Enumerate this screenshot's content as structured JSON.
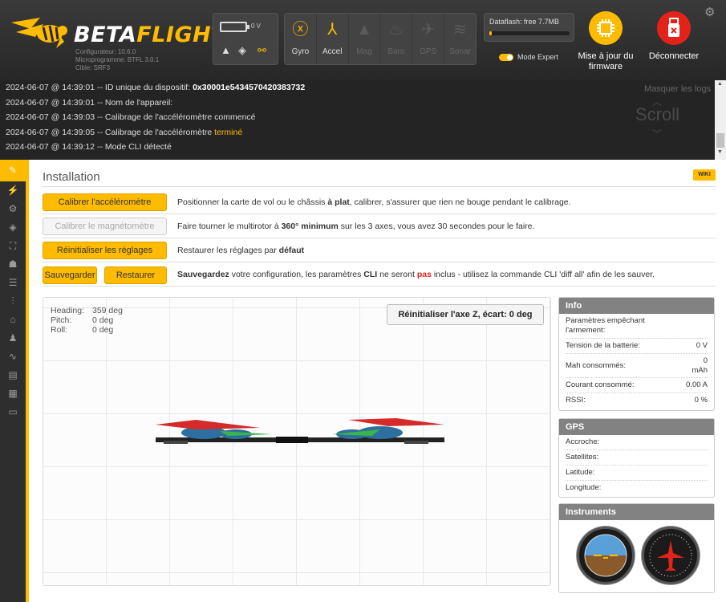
{
  "app": {
    "logo_part1": "BETA",
    "logo_part2": "FLIGHT",
    "configurator": "Configurateur: 10.6.0",
    "firmware": "Microprogramme: BTFL 3.0.1",
    "target": "Cible: SRF3"
  },
  "battery": {
    "voltage": "0 V"
  },
  "sensors": [
    {
      "label": "Gyro",
      "icon": "gyro-icon",
      "active": true
    },
    {
      "label": "Accel",
      "icon": "accel-icon",
      "active": true
    },
    {
      "label": "Mag",
      "icon": "mag-icon",
      "active": false
    },
    {
      "label": "Baro",
      "icon": "baro-icon",
      "active": false
    },
    {
      "label": "GPS",
      "icon": "gps-icon",
      "active": false
    },
    {
      "label": "Sonar",
      "icon": "sonar-icon",
      "active": false
    }
  ],
  "dataflash": {
    "label": "Dataflash: free 7.7MB",
    "used_fraction": 0.03
  },
  "expert_mode": {
    "label": "Mode Expert",
    "enabled": true
  },
  "header_buttons": {
    "firmware_update": "Mise à jour du firmware",
    "disconnect": "Déconnecter"
  },
  "log": {
    "lines": [
      {
        "prefix": "2024-06-07 @ 14:39:01 -- ID unique du dispositif: ",
        "bold": "0x30001e5434570420383732",
        "suffix": ""
      },
      {
        "prefix": "2024-06-07 @ 14:39:01 -- Nom de l'appareil:",
        "bold": "",
        "suffix": ""
      },
      {
        "prefix": "2024-06-07 @ 14:39:03 -- Calibrage de l'accéléromètre commencé",
        "bold": "",
        "suffix": ""
      },
      {
        "prefix": "2024-06-07 @ 14:39:05 -- Calibrage de l'accéléromètre ",
        "bold": "",
        "suffix": "terminé"
      },
      {
        "prefix": "2024-06-07 @ 14:39:12 -- Mode CLI détecté",
        "bold": "",
        "suffix": ""
      }
    ],
    "hide_label": "Masquer les logs",
    "scroll_label": "Scroll"
  },
  "sidebar": [
    {
      "name": "nav-setup",
      "icon": "wrench-icon",
      "glyph": "✎",
      "active": true
    },
    {
      "name": "nav-ports",
      "icon": "plug-icon",
      "glyph": "⚡",
      "active": false
    },
    {
      "name": "nav-configuration",
      "icon": "gear-icon",
      "glyph": "⚙",
      "active": false
    },
    {
      "name": "nav-failsafe",
      "icon": "shield-icon",
      "glyph": "◈",
      "active": false
    },
    {
      "name": "nav-pid",
      "icon": "pid-icon",
      "glyph": "⛶",
      "active": false
    },
    {
      "name": "nav-receiver",
      "icon": "receiver-icon",
      "glyph": "☗",
      "active": false
    },
    {
      "name": "nav-modes",
      "icon": "modes-icon",
      "glyph": "☰",
      "active": false
    },
    {
      "name": "nav-adjustments",
      "icon": "sliders-icon",
      "glyph": "⫶",
      "active": false
    },
    {
      "name": "nav-servos",
      "icon": "servo-icon",
      "glyph": "⌂",
      "active": false
    },
    {
      "name": "nav-motors",
      "icon": "motor-icon",
      "glyph": "♟",
      "active": false
    },
    {
      "name": "nav-sensors",
      "icon": "sensors-icon",
      "glyph": "∿",
      "active": false
    },
    {
      "name": "nav-blackbox",
      "icon": "blackbox-icon",
      "glyph": "▤",
      "active": false
    },
    {
      "name": "nav-led",
      "icon": "led-icon",
      "glyph": "▦",
      "active": false
    },
    {
      "name": "nav-cli",
      "icon": "cli-icon",
      "glyph": "▭",
      "active": false
    }
  ],
  "setup": {
    "title": "Installation",
    "wiki": "WIKI",
    "calibrate_acc": {
      "label": "Calibrer l'accéléromètre",
      "desc_1": "Positionner la carte de vol ou le châssis ",
      "desc_b": "à plat",
      "desc_2": ", calibrer, s'assurer que rien ne bouge pendant le calibrage."
    },
    "calibrate_mag": {
      "label": "Calibrer le magnétomètre",
      "desc_1": "Faire tourner le multirotor à ",
      "desc_b": "360° minimum",
      "desc_2": " sur les 3 axes, vous avez 30 secondes pour le faire."
    },
    "reset_settings": {
      "label": "Réinitialiser les réglages",
      "desc_1": "Restaurer les réglages par ",
      "desc_b": "défaut"
    },
    "backup": {
      "save_label": "Sauvegarder",
      "restore_label": "Restaurer",
      "desc_b1": "Sauvegardez",
      "desc_1": " votre configuration, les paramètres ",
      "desc_b2": "CLI",
      "desc_2": " ne seront ",
      "desc_red": "pas",
      "desc_3": " inclus - utilisez la commande CLI 'diff all' afin de les sauver."
    },
    "attitude": {
      "heading_label": "Heading:",
      "heading": "359 deg",
      "pitch_label": "Pitch:",
      "pitch": "0 deg",
      "roll_label": "Roll:",
      "roll": "0 deg"
    },
    "reset_z": "Réinitialiser l'axe Z, écart: 0 deg"
  },
  "info": {
    "title": "Info",
    "rows": [
      {
        "label": "Paramètres empêchant l'armement:",
        "value": ""
      },
      {
        "label": "Tension de la batterie:",
        "value": "0 V"
      },
      {
        "label": "Mah consommés:",
        "value": "0 mAh"
      },
      {
        "label": "Courant consommé:",
        "value": "0.00 A"
      },
      {
        "label": "RSSI:",
        "value": "0 %"
      }
    ]
  },
  "gps": {
    "title": "GPS",
    "rows": [
      "Accroche:",
      "Satellites:",
      "Latitude:",
      "Longitude:"
    ]
  },
  "instruments": {
    "title": "Instruments"
  },
  "colors": {
    "accent": "#ffbb00",
    "disconnect": "#e2231a"
  }
}
